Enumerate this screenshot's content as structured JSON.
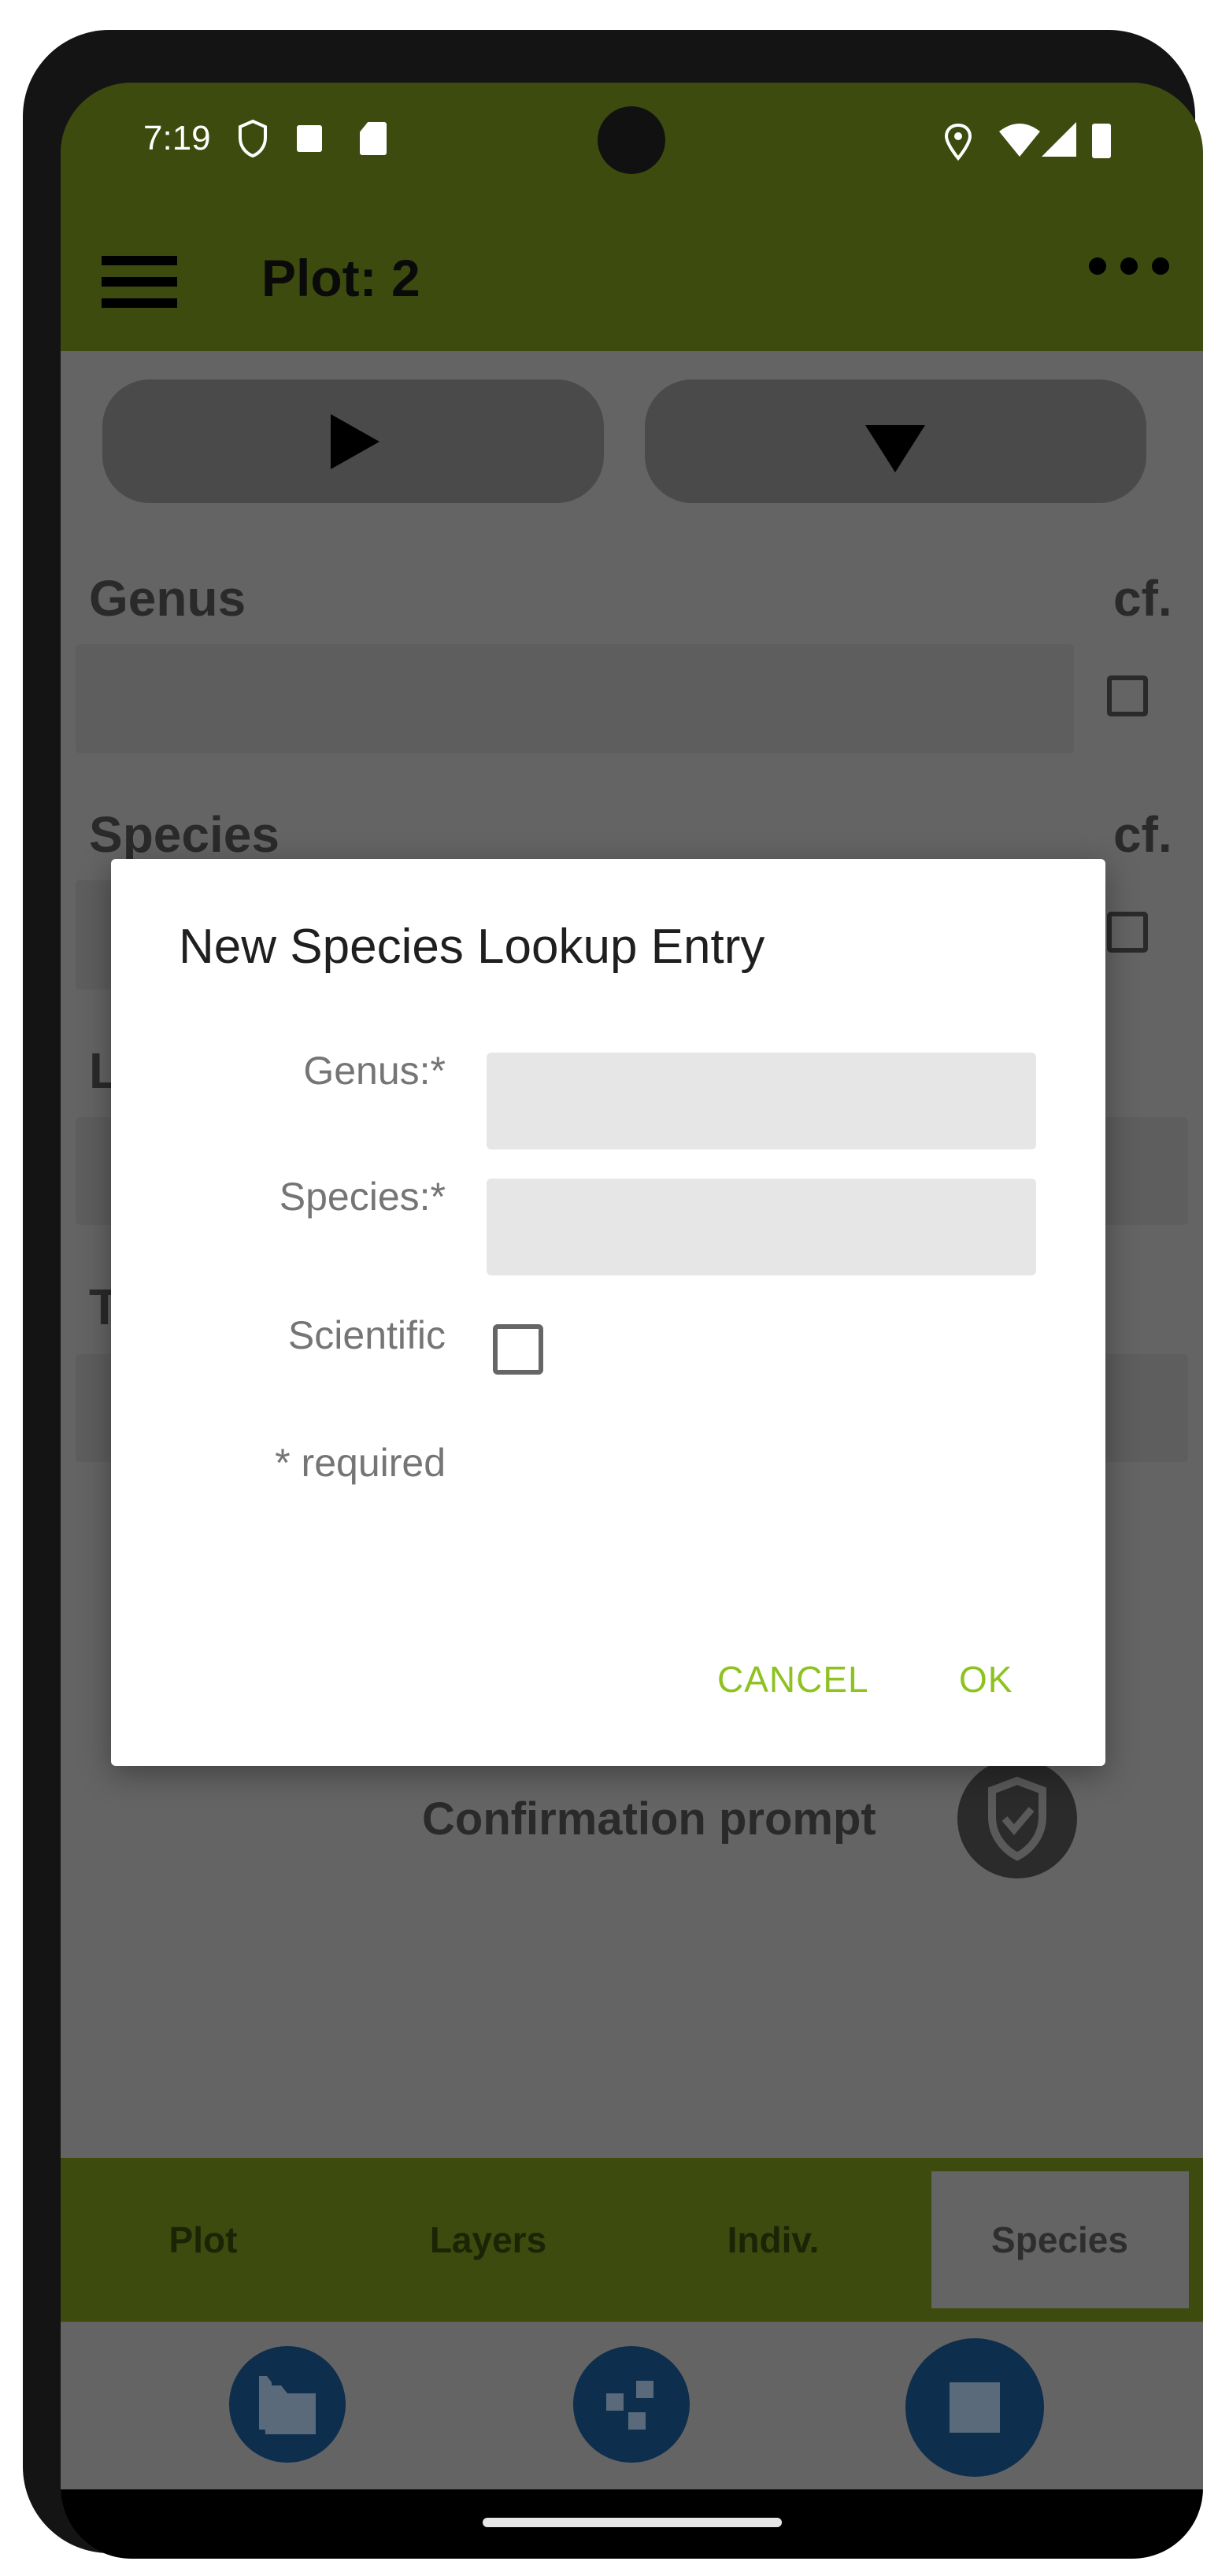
{
  "status_bar": {
    "time": "7:19"
  },
  "app_bar": {
    "title": "Plot: 2"
  },
  "form": {
    "genus_label": "Genus",
    "species_label": "Species",
    "cf_label": "cf.",
    "layer_label_partial": "La",
    "taxon_label_partial": "Ta",
    "confirmation_label": "Confirmation prompt"
  },
  "dialog": {
    "title": "New Species Lookup Entry",
    "genus_label": "Genus:*",
    "species_label": "Species:*",
    "scientific_label": "Scientific",
    "required_note": "* required",
    "genus_value": "",
    "species_value": "",
    "scientific_checked": false,
    "cancel_label": "CANCEL",
    "ok_label": "OK"
  },
  "tabs": [
    {
      "label": "Plot",
      "selected": false
    },
    {
      "label": "Layers",
      "selected": false
    },
    {
      "label": "Indiv.",
      "selected": false
    },
    {
      "label": "Species",
      "selected": true
    }
  ],
  "colors": {
    "app_bar": "#3d4b0e",
    "accent": "#8dc21f",
    "fab": "#0d2e4c",
    "overlay_bg": "#646464"
  }
}
